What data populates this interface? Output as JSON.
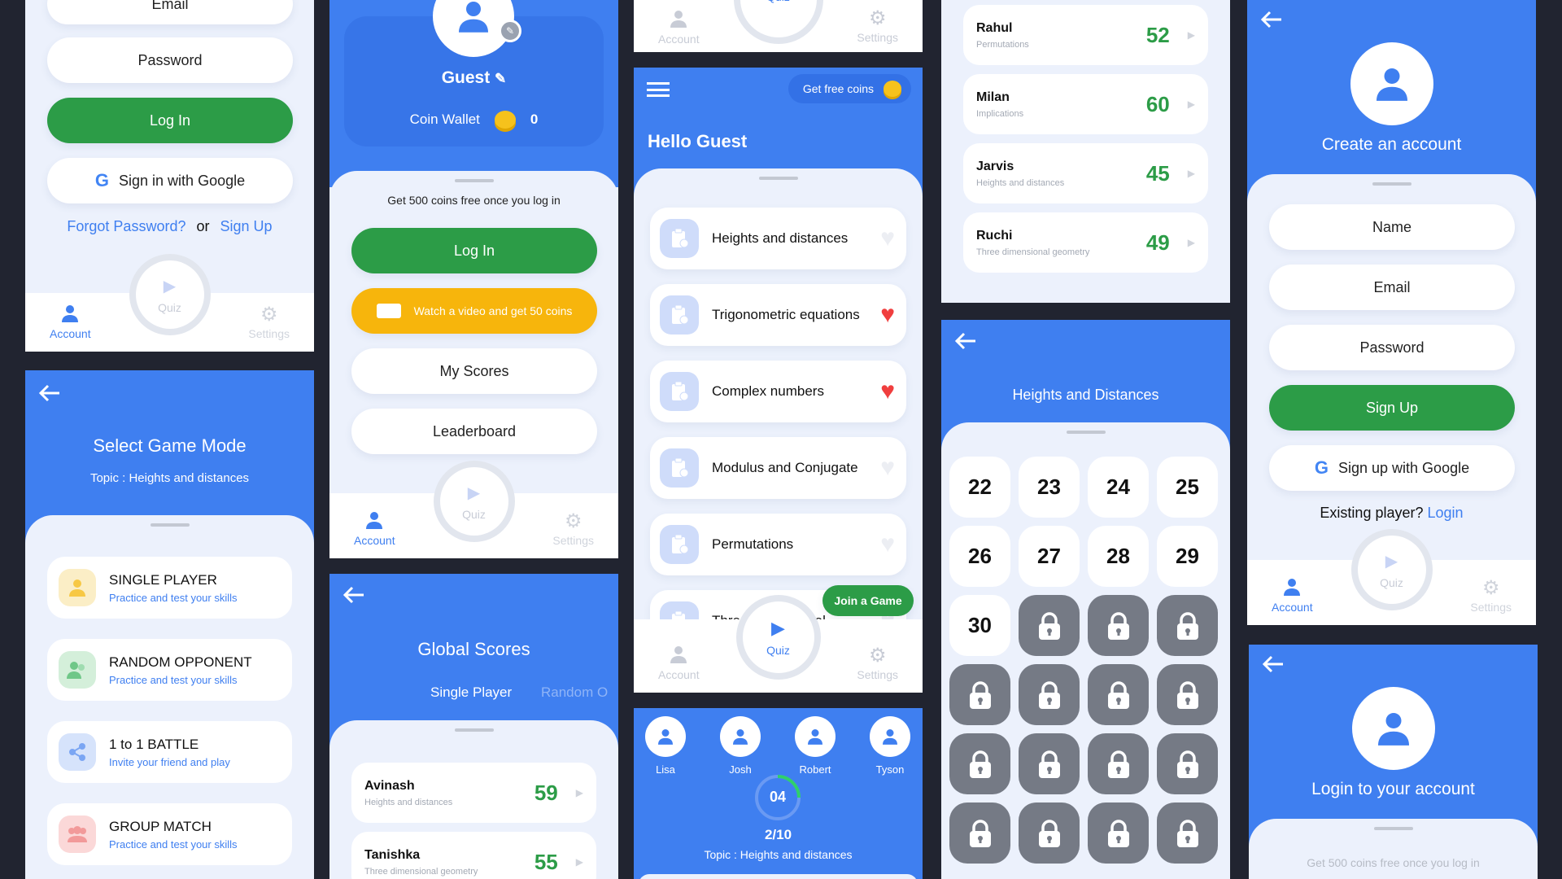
{
  "login": {
    "email": "Email",
    "password": "Password",
    "login": "Log In",
    "google": "Sign in with Google",
    "forgot": "Forgot Password?",
    "or": "or",
    "signup": "Sign Up"
  },
  "nav": {
    "account": "Account",
    "quiz": "Quiz",
    "settings": "Settings"
  },
  "profile": {
    "name": "Guest",
    "wallet": "Coin Wallet",
    "coins": "0",
    "promo": "Get 500 coins free once you log in",
    "login": "Log In",
    "video": "Watch a video and get 50 coins",
    "scores": "My Scores",
    "leaderboard": "Leaderboard"
  },
  "home": {
    "free_coins": "Get free coins",
    "greeting": "Hello Guest",
    "join": "Join a Game",
    "topics": [
      {
        "label": "Heights and distances",
        "fav": false
      },
      {
        "label": "Trigonometric equations",
        "fav": true
      },
      {
        "label": "Complex numbers",
        "fav": true
      },
      {
        "label": "Modulus and Conjugate",
        "fav": false
      },
      {
        "label": "Permutations",
        "fav": false
      },
      {
        "label": "Three dimensional",
        "fav": false
      }
    ]
  },
  "mode": {
    "title": "Select Game Mode",
    "topic": "Topic : Heights and distances",
    "items": [
      {
        "title": "SINGLE PLAYER",
        "sub": "Practice and test your skills",
        "bg": "#fbeec6",
        "fg": "#f7b50c"
      },
      {
        "title": "RANDOM OPPONENT",
        "sub": "Practice and test your skills",
        "bg": "#d4efda",
        "fg": "#49b766"
      },
      {
        "title": "1 to 1 BATTLE",
        "sub": "Invite your friend and play",
        "bg": "#d6e3fb",
        "fg": "#5d90f1"
      },
      {
        "title": "GROUP MATCH",
        "sub": "Practice and test your skills",
        "bg": "#fbd8d8",
        "fg": "#f07d7d"
      }
    ]
  },
  "global": {
    "title": "Global Scores",
    "tab1": "Single Player",
    "tab2": "Random O",
    "rows": [
      {
        "name": "Avinash",
        "topic": "Heights and distances",
        "score": "59"
      },
      {
        "name": "Tanishka",
        "topic": "Three dimensional geometry",
        "score": "55"
      }
    ]
  },
  "players": {
    "names": [
      "Lisa",
      "Josh",
      "Robert",
      "Tyson"
    ],
    "timer": "04",
    "progress": "2/10",
    "topic": "Topic : Heights and distances"
  },
  "scores2": [
    {
      "name": "Rahul",
      "topic": "Permutations",
      "score": "52"
    },
    {
      "name": "Milan",
      "topic": "Implications",
      "score": "60"
    },
    {
      "name": "Jarvis",
      "topic": "Heights and distances",
      "score": "45"
    },
    {
      "name": "Ruchi",
      "topic": "Three dimensional geometry",
      "score": "49"
    }
  ],
  "levels": {
    "title": "Heights and Distances",
    "open": [
      "22",
      "23",
      "24",
      "25",
      "26",
      "27",
      "28",
      "29",
      "30"
    ],
    "locked": 15
  },
  "signup": {
    "title": "Create an account",
    "name": "Name",
    "email": "Email",
    "password": "Password",
    "signup": "Sign Up",
    "google": "Sign up with Google",
    "existing": "Existing player?",
    "login": "Login"
  },
  "loginacct": {
    "title": "Login to your account",
    "promo": "Get 500 coins free once you log in"
  }
}
